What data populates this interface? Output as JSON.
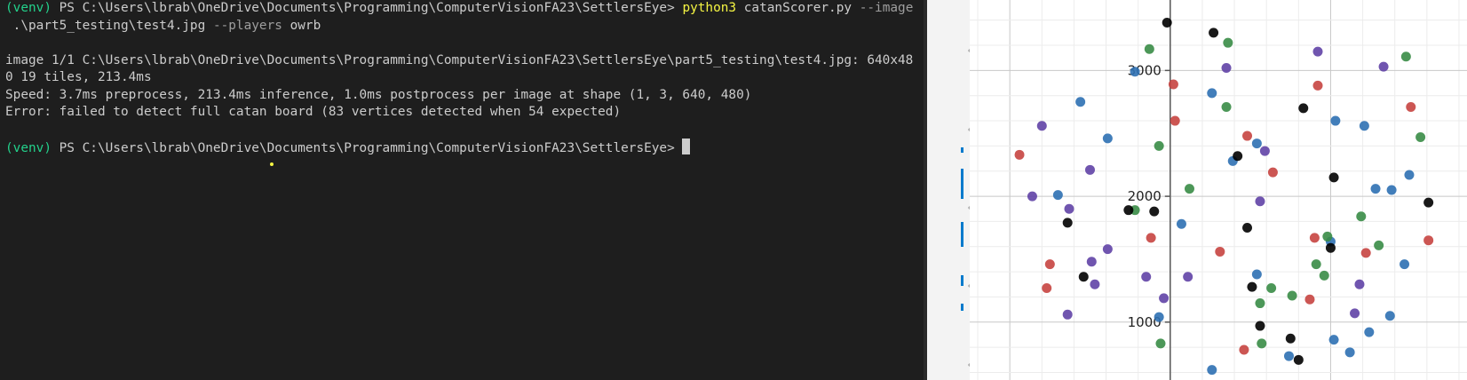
{
  "terminal": {
    "lines": [
      {
        "venv": "(venv)",
        "prompt": " PS C:\\Users\\lbrab\\OneDrive\\Documents\\Programming\\ComputerVisionFA23\\SettlersEye> ",
        "cmd": "python3",
        "args": " catanScorer.py ",
        "flag1": "--image"
      },
      {
        "text": " .\\part5_testing\\test4.jpg ",
        "flag2": "--players",
        "value": " owrb"
      },
      {
        "text": ""
      },
      {
        "text": "image 1/1 C:\\Users\\lbrab\\OneDrive\\Documents\\Programming\\ComputerVisionFA23\\SettlersEye\\part5_testing\\test4.jpg: 640x48"
      },
      {
        "text": "0 19 tiles, 213.4ms"
      },
      {
        "text": "Speed: 3.7ms preprocess, 213.4ms inference, 1.0ms postprocess per image at shape (1, 3, 640, 480)"
      },
      {
        "text": "Error: failed to detect full catan board (83 vertices detected when 54 expected)"
      },
      {
        "text": ""
      },
      {
        "venv": "(venv)",
        "prompt": " PS C:\\Users\\lbrab\\OneDrive\\Documents\\Programming\\ComputerVisionFA23\\SettlersEye> "
      }
    ]
  },
  "colors": {
    "terminal_bg": "#1e1e1e",
    "venv_green": "#23d18b",
    "cmd_yellow": "#f5f543",
    "red": "#c74440",
    "blue": "#2d70b3",
    "green": "#388c46",
    "purple": "#6042a6",
    "black": "#000000"
  },
  "chart_data": {
    "type": "scatter",
    "ytick_labels": [
      "3000",
      "2000",
      "1000"
    ],
    "yticks": [
      3000,
      2000,
      1000
    ],
    "ylim": [
      540,
      3560
    ],
    "xlim": [
      -1250,
      1850
    ],
    "grid": true,
    "series": [
      {
        "color": "red",
        "points": [
          [
            -940,
            2330
          ],
          [
            -750,
            1460
          ],
          [
            -770,
            1270
          ],
          [
            -120,
            1670
          ],
          [
            20,
            2890
          ],
          [
            30,
            2600
          ],
          [
            310,
            1560
          ],
          [
            480,
            2480
          ],
          [
            640,
            2190
          ],
          [
            460,
            780
          ],
          [
            870,
            1180
          ],
          [
            900,
            1670
          ],
          [
            920,
            2880
          ],
          [
            1220,
            1550
          ],
          [
            1500,
            2710
          ],
          [
            1610,
            1650
          ]
        ]
      },
      {
        "color": "blue",
        "points": [
          [
            -560,
            2750
          ],
          [
            -390,
            2460
          ],
          [
            -700,
            2010
          ],
          [
            -220,
            2990
          ],
          [
            260,
            2820
          ],
          [
            540,
            2420
          ],
          [
            390,
            2280
          ],
          [
            70,
            1780
          ],
          [
            -70,
            1040
          ],
          [
            260,
            620
          ],
          [
            540,
            1380
          ],
          [
            740,
            730
          ],
          [
            1030,
            2600
          ],
          [
            1210,
            2560
          ],
          [
            1000,
            1640
          ],
          [
            1280,
            2060
          ],
          [
            1380,
            2050
          ],
          [
            1490,
            2170
          ],
          [
            1460,
            1460
          ],
          [
            1370,
            1050
          ],
          [
            1240,
            920
          ],
          [
            1120,
            760
          ],
          [
            1020,
            860
          ]
        ]
      },
      {
        "color": "green",
        "points": [
          [
            -130,
            3170
          ],
          [
            -70,
            2400
          ],
          [
            -220,
            1890
          ],
          [
            120,
            2060
          ],
          [
            350,
            2710
          ],
          [
            360,
            3220
          ],
          [
            630,
            1270
          ],
          [
            560,
            1150
          ],
          [
            570,
            830
          ],
          [
            -60,
            830
          ],
          [
            760,
            1210
          ],
          [
            910,
            1460
          ],
          [
            960,
            1370
          ],
          [
            980,
            1680
          ],
          [
            1190,
            1840
          ],
          [
            1300,
            1610
          ],
          [
            1470,
            3110
          ],
          [
            1560,
            2470
          ]
        ]
      },
      {
        "color": "purple",
        "points": [
          [
            -800,
            2560
          ],
          [
            -860,
            2000
          ],
          [
            -630,
            1900
          ],
          [
            -640,
            1060
          ],
          [
            -500,
            2210
          ],
          [
            -490,
            1480
          ],
          [
            -470,
            1300
          ],
          [
            -390,
            1580
          ],
          [
            -150,
            1360
          ],
          [
            110,
            1360
          ],
          [
            -40,
            1190
          ],
          [
            350,
            3020
          ],
          [
            560,
            1960
          ],
          [
            590,
            2360
          ],
          [
            920,
            3150
          ],
          [
            1330,
            3030
          ],
          [
            1180,
            1300
          ],
          [
            1150,
            1070
          ]
        ]
      },
      {
        "color": "black",
        "points": [
          [
            -640,
            1790
          ],
          [
            -540,
            1360
          ],
          [
            -260,
            1890
          ],
          [
            -100,
            1880
          ],
          [
            -20,
            3380
          ],
          [
            270,
            3300
          ],
          [
            420,
            2320
          ],
          [
            480,
            1750
          ],
          [
            510,
            1280
          ],
          [
            560,
            970
          ],
          [
            750,
            870
          ],
          [
            800,
            700
          ],
          [
            830,
            2700
          ],
          [
            1020,
            2150
          ],
          [
            1000,
            1590
          ],
          [
            1610,
            1950
          ]
        ]
      }
    ]
  }
}
